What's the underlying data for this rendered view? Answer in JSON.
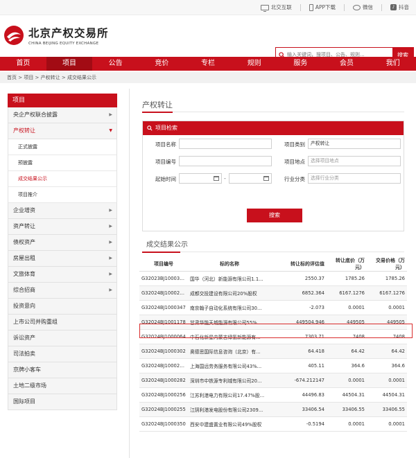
{
  "utility": {
    "items": [
      {
        "label": "北交互联",
        "icon": "tv-icon"
      },
      {
        "label": "APP下载",
        "icon": "phone-icon"
      },
      {
        "label": "微信",
        "icon": "wechat-icon"
      },
      {
        "label": "抖音",
        "icon": "douyin-icon"
      }
    ]
  },
  "brand": {
    "name_cn": "北京产权交易所",
    "name_en": "CHINA BEIJING EQUITY EXCHANGE",
    "color": "#c8101c"
  },
  "search": {
    "placeholder": "输入关键词，搜项目、公告、规则...",
    "button": "搜索"
  },
  "nav": {
    "items": [
      "首页",
      "项目",
      "公告",
      "竞价",
      "专栏",
      "规则",
      "服务",
      "会员",
      "我们"
    ],
    "active_index": 1
  },
  "breadcrumb": "首页 > 项目 > 产权转让 > 成交结果公示",
  "sidebar": {
    "header": "项目",
    "items": [
      {
        "label": "央企产权联合披露",
        "arrow": "▶"
      },
      {
        "label": "产权转让",
        "arrow": "▼",
        "open": true
      },
      {
        "label": "企业增资",
        "arrow": "▶"
      },
      {
        "label": "资产转让",
        "arrow": "▶"
      },
      {
        "label": "债权资产",
        "arrow": "▶"
      },
      {
        "label": "房屋出租",
        "arrow": "▶"
      },
      {
        "label": "文旅体育",
        "arrow": "▶"
      },
      {
        "label": "综合招商",
        "arrow": "▶"
      },
      {
        "label": "投资意向"
      },
      {
        "label": "上市公司并购重组"
      },
      {
        "label": "诉讼资产"
      },
      {
        "label": "司法拍卖"
      },
      {
        "label": "京牌小客车"
      },
      {
        "label": "土地二级市场"
      },
      {
        "label": "国际项目"
      }
    ],
    "sub_items": [
      "正式披露",
      "预披露",
      "成交结果公示",
      "项目推介"
    ],
    "current_sub": 2
  },
  "main": {
    "title": "产权转让",
    "search_panel": {
      "title": "项目检索",
      "name_label": "项目名称",
      "name_value": "",
      "type_label": "项目类别",
      "type_value": "产权转让",
      "code_label": "项目编号",
      "code_value": "",
      "location_label": "项目地点",
      "location_placeholder": "选择项目地点",
      "time_label": "起始时间",
      "time_separator": "-",
      "industry_label": "行业分类",
      "industry_placeholder": "选择行业分类",
      "button": "搜索"
    },
    "results": {
      "title": "成交结果公示",
      "columns": [
        "项目编号",
        "标的名称",
        "转让标的评估值",
        "转让底价（万元）",
        "交易价格（万元）"
      ],
      "rows": [
        [
          "G32023BJ1000370-4",
          "国华（河北）新能源有限公司1.1...",
          "2550.37",
          "1785.26",
          "1785.26"
        ],
        [
          "G32024BJ1000274-2",
          "成都交投建设有限公司20%股权",
          "6852.364",
          "6167.1276",
          "6167.1276"
        ],
        [
          "G32024BJ1000347",
          "南京翰子自动化系统有限公司30...",
          "-2.073",
          "0.0001",
          "0.0001"
        ],
        [
          "G32024BJ1001178",
          "甘肃华能天城能源有限公司55%...",
          "449504.946",
          "449505",
          "449505"
        ],
        [
          "G32024BJ1000064",
          "中石化新星内蒙古绿氢新能源有...",
          "7303.71",
          "7408",
          "7408"
        ],
        [
          "G32024BJ1000302",
          "奥德思国际信息咨询（北京）有...",
          "64.418",
          "64.42",
          "64.42"
        ],
        [
          "G32024BJ1000230-2",
          "上海国远劳务服务有限公司43%...",
          "405.11",
          "364.6",
          "364.6"
        ],
        [
          "G32024BJ1000282",
          "深圳市中铁源专利城有限公司20...",
          "-674.212147",
          "0.0001",
          "0.0001"
        ],
        [
          "G32024BJ1000256",
          "江苏利港电力有限公司17.47%股...",
          "44496.83",
          "44504.31",
          "44504.31"
        ],
        [
          "G32024BJ1000255",
          "江阴利港发电股份有限公司2309...",
          "33406.54",
          "33406.55",
          "33406.55"
        ],
        [
          "G32024BJ1000350",
          "西安中建盛置业有限公司49%股权",
          "-0.5194",
          "0.0001",
          "0.0001"
        ]
      ],
      "highlighted_row": 4
    }
  }
}
